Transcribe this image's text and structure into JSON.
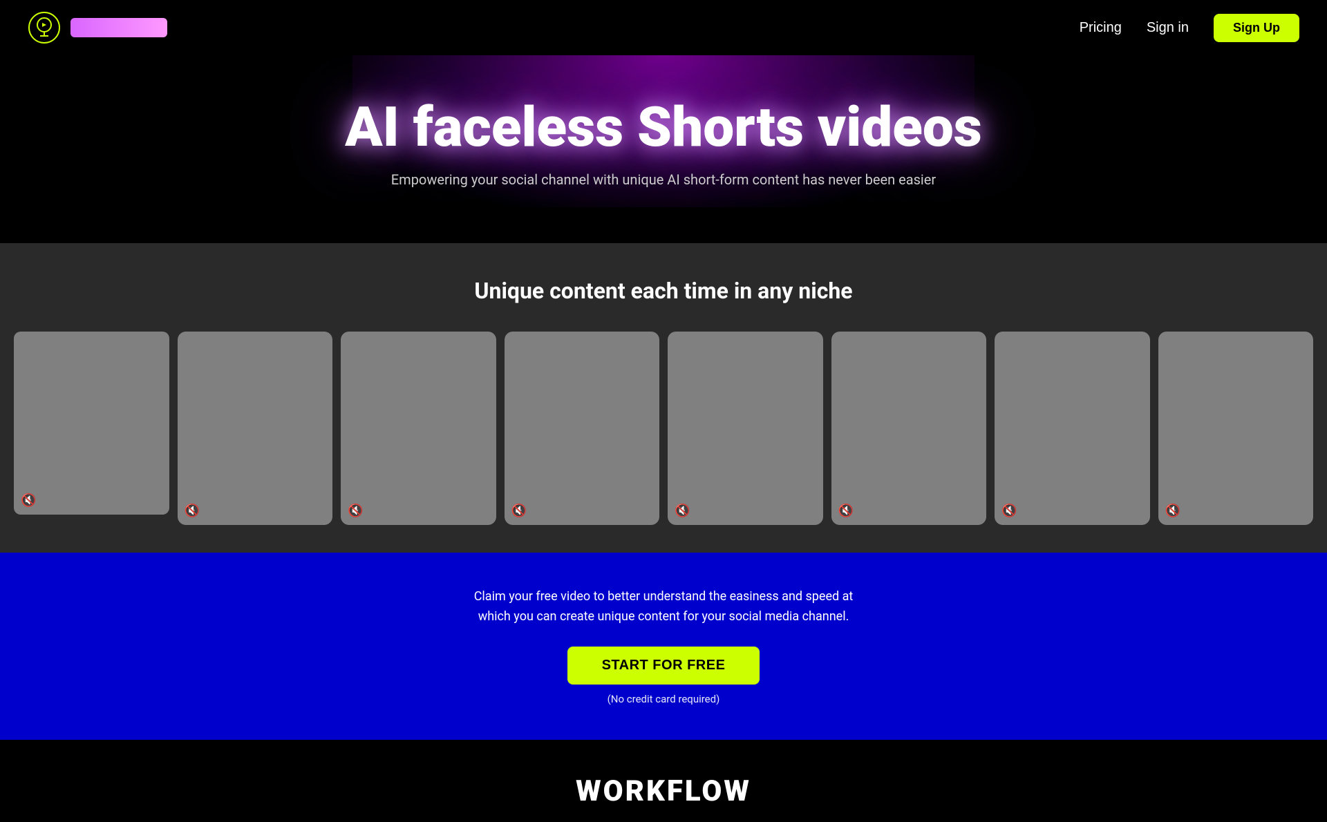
{
  "nav": {
    "logo_alt": "AI Logo",
    "pricing_label": "Pricing",
    "signin_label": "Sign in",
    "signup_label": "Sign Up"
  },
  "hero": {
    "title": "AI faceless Shorts videos",
    "subtitle": "Empowering your social channel with unique AI short-form content has never been easier"
  },
  "video_section": {
    "title": "Unique content each time in any niche",
    "cards": [
      {
        "id": 1,
        "mute": true
      },
      {
        "id": 2,
        "mute": true
      },
      {
        "id": 3,
        "mute": true
      },
      {
        "id": 4,
        "mute": true
      },
      {
        "id": 5,
        "mute": true
      },
      {
        "id": 6,
        "mute": true
      },
      {
        "id": 7,
        "mute": true
      },
      {
        "id": 8,
        "mute": true
      }
    ],
    "mute_icon": "🔇"
  },
  "cta": {
    "description": "Claim your free video to better understand the easiness and speed at which you can create unique content for your social media channel.",
    "button_label": "START FOR FREE",
    "note": "(No credit card required)"
  },
  "workflow": {
    "title": "WORKFLOW"
  }
}
